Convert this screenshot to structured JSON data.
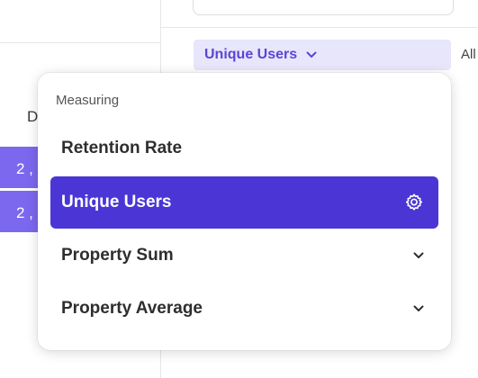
{
  "background": {
    "column_header": "D",
    "rows": [
      "2 ,",
      "2 ,"
    ],
    "measure_selector": {
      "label": "Unique Users",
      "icon": "chevron-down-icon"
    },
    "side_label": "All"
  },
  "menu": {
    "heading": "Measuring",
    "items": [
      {
        "label": "Retention Rate",
        "selected": false,
        "trailing_icon": null
      },
      {
        "label": "Unique Users",
        "selected": true,
        "trailing_icon": "gear-icon"
      },
      {
        "label": "Property Sum",
        "selected": false,
        "trailing_icon": "chevron-down-icon"
      },
      {
        "label": "Property Average",
        "selected": false,
        "trailing_icon": "chevron-down-icon"
      }
    ]
  },
  "colors": {
    "accent": "#4b35d5",
    "accent_light": "#e8e6fa",
    "row_fill": "#7b68ee"
  }
}
